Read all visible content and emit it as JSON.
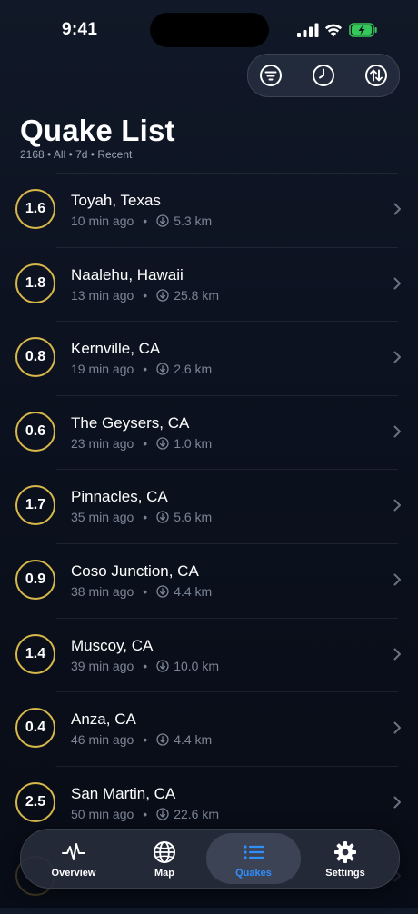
{
  "status_bar": {
    "time": "9:41"
  },
  "toolbar": {
    "icons": [
      "filter-icon",
      "clock-icon",
      "sort-icon"
    ]
  },
  "header": {
    "title": "Quake List",
    "subtitle": "2168 • All • 7d • Recent"
  },
  "colors": {
    "magnitude_ring": "#d8b84a",
    "accent": "#2f8fff",
    "background": "#0c1220"
  },
  "quakes": [
    {
      "mag": "1.6",
      "place": "Toyah, Texas",
      "time": "10 min ago",
      "depth": "5.3 km"
    },
    {
      "mag": "1.8",
      "place": "Naalehu, Hawaii",
      "time": "13 min ago",
      "depth": "25.8 km"
    },
    {
      "mag": "0.8",
      "place": "Kernville, CA",
      "time": "19 min ago",
      "depth": "2.6 km"
    },
    {
      "mag": "0.6",
      "place": "The Geysers, CA",
      "time": "23 min ago",
      "depth": "1.0 km"
    },
    {
      "mag": "1.7",
      "place": "Pinnacles, CA",
      "time": "35 min ago",
      "depth": "5.6 km"
    },
    {
      "mag": "0.9",
      "place": "Coso Junction, CA",
      "time": "38 min ago",
      "depth": "4.4 km"
    },
    {
      "mag": "1.4",
      "place": "Muscoy, CA",
      "time": "39 min ago",
      "depth": "10.0 km"
    },
    {
      "mag": "0.4",
      "place": "Anza, CA",
      "time": "46 min ago",
      "depth": "4.4 km"
    },
    {
      "mag": "2.5",
      "place": "San Martin, CA",
      "time": "50 min ago",
      "depth": "22.6 km"
    },
    {
      "mag": "",
      "place": "",
      "time": "",
      "depth": ""
    }
  ],
  "tabbar": {
    "tabs": [
      {
        "label": "Overview",
        "icon": "waveform-icon"
      },
      {
        "label": "Map",
        "icon": "globe-icon"
      },
      {
        "label": "Quakes",
        "icon": "list-icon",
        "active": true
      },
      {
        "label": "Settings",
        "icon": "gear-icon"
      }
    ]
  }
}
